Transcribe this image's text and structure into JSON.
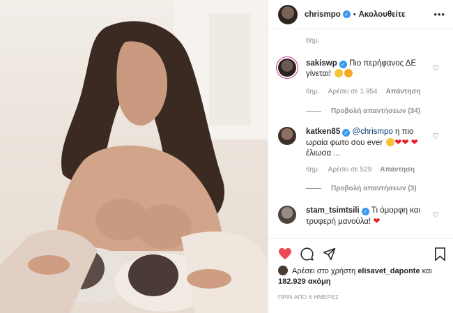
{
  "post": {
    "username": "chrismpo",
    "follow_status": "Ακολουθείτε",
    "more": "•••",
    "top_time": "6ημ."
  },
  "comments": [
    {
      "username": "sakiswp",
      "text": "Πιο περήφανος ΔΕ γίνεται!",
      "time": "6ημ.",
      "likes": "Αρέσει σε 1.954",
      "reply": "Απάντηση",
      "view_replies": "Προβολή απαντήσεων (34)"
    },
    {
      "username": "katken85",
      "mention": "@chrismpo",
      "text": "η πιο ωραία φωτο σου ever",
      "text2": "έλιωσα ...",
      "time": "6ημ.",
      "likes": "Αρέσει σε 529",
      "reply": "Απάντηση",
      "view_replies": "Προβολή απαντήσεων (3)"
    },
    {
      "username": "stam_tsimtsili",
      "text": "Τι όμορφη και τρυφερή μανούλα!"
    }
  ],
  "likes_line": {
    "prefix": "Αρέσει στο χρήστη",
    "user": "elisavet_daponte",
    "middle": "και",
    "count": "182.929 ακόμη"
  },
  "posted_ago": "ΠΡΙΝ ΑΠΟ 6 ΗΜΕΡΕΣ",
  "colors": {
    "accent": "#3897f0",
    "highlight": "#e02020",
    "like": "#ed4956"
  }
}
